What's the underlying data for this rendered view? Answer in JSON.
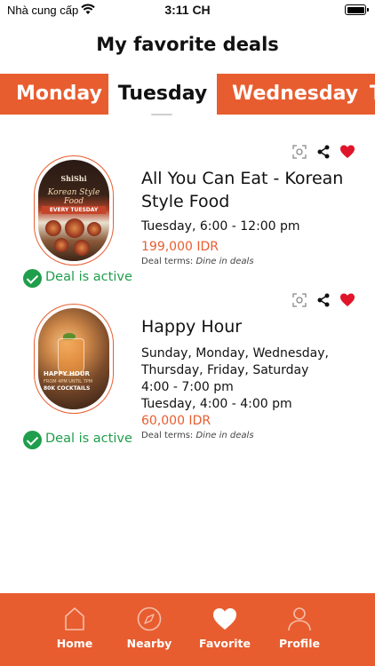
{
  "status_bar": {
    "carrier": "Nhà cung cấp",
    "time": "3:11 CH"
  },
  "header": {
    "title": "My favorite deals"
  },
  "tabs": [
    {
      "label": "Monday",
      "selected": false
    },
    {
      "label": "Tuesday",
      "selected": true
    },
    {
      "label": "Wednesday",
      "selected": false
    },
    {
      "label": "T",
      "selected": false
    }
  ],
  "deals": [
    {
      "title": "All You Can Eat - Korean Style Food",
      "schedule": "Tuesday, 6:00 - 12:00 pm",
      "price": "199,000 IDR",
      "terms_label": "Deal terms:",
      "terms_value": "Dine in deals",
      "status": "Deal is active",
      "favorited": true,
      "image": {
        "brand": "ShiShi",
        "script": "Korean Style Food",
        "strip": "EVERY TUESDAY"
      }
    },
    {
      "title": "Happy Hour",
      "schedule": "Sunday, Monday, Wednesday, Thursday, Friday, Saturday\n4:00 - 7:00 pm\nTuesday, 4:00 - 4:00 pm",
      "price": "60,000 IDR",
      "terms_label": "Deal terms:",
      "terms_value": "Dine in deals",
      "status": "Deal is active",
      "favorited": true,
      "image": {
        "headline": "HAPPY HOUR",
        "subline": "FROM 4PM UNTIL 7PM",
        "offer": "80K COCKTAILS"
      }
    }
  ],
  "bottom_nav": [
    {
      "label": "Home",
      "icon": "home-icon"
    },
    {
      "label": "Nearby",
      "icon": "compass-icon"
    },
    {
      "label": "Favorite",
      "icon": "heart-icon",
      "active": true
    },
    {
      "label": "Profile",
      "icon": "person-icon"
    }
  ],
  "colors": {
    "accent": "#e85d2f",
    "active_green": "#1f9e4b",
    "favorite_red": "#e0152a"
  }
}
